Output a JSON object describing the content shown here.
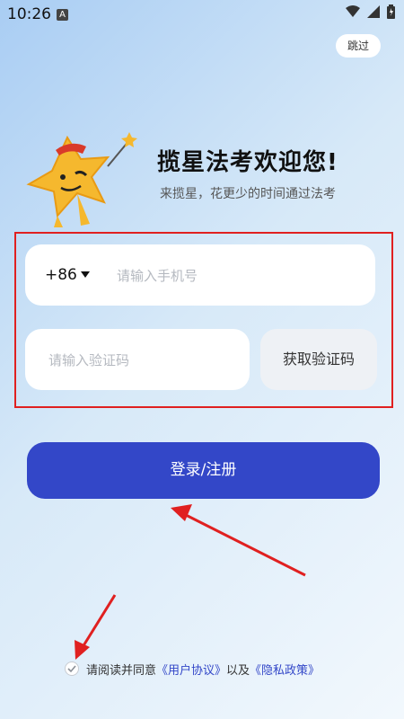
{
  "status_bar": {
    "time": "10:26",
    "notification_badge": "A"
  },
  "header": {
    "skip_label": "跳过"
  },
  "welcome": {
    "title": "揽星法考欢迎您!",
    "subtitle": "来揽星，花更少的时间通过法考"
  },
  "form": {
    "country_code": "+86",
    "phone_placeholder": "请输入手机号",
    "code_placeholder": "请输入验证码",
    "get_code_label": "获取验证码"
  },
  "login": {
    "label": "登录/注册"
  },
  "agreement": {
    "prefix": "请阅读并同意",
    "user_agreement": "《用户协议》",
    "connector": "以及",
    "privacy_policy": "《隐私政策》",
    "checked": true
  },
  "colors": {
    "primary": "#3347c8",
    "annotation": "#e02020",
    "mascot": "#f5b82e"
  },
  "icons": [
    "wifi-icon",
    "signal-icon",
    "battery-icon",
    "dropdown-arrow-icon",
    "check-icon",
    "mascot-star-icon"
  ]
}
